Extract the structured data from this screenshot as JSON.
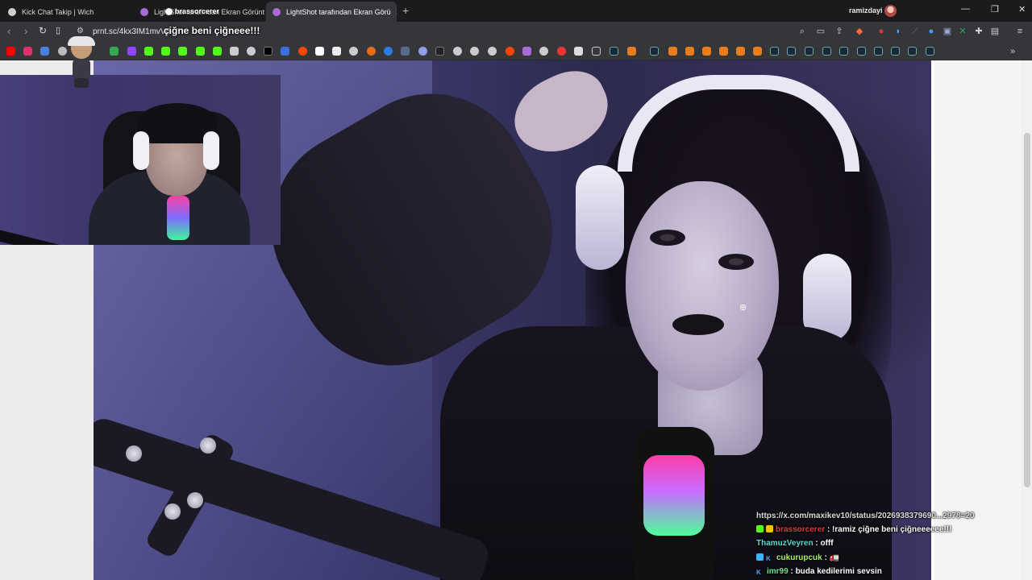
{
  "browser": {
    "tabs": [
      {
        "title": "Kick Chat Takip | Wich",
        "active": false
      },
      {
        "title": "LightShot tarafından Ekran Görüntüs",
        "active": false
      },
      {
        "title": "LightShot tarafından Ekran Görü",
        "active": true
      }
    ],
    "new_tab_label": "+",
    "close_tab_label": "×",
    "profile_name": "ramizdayi",
    "url": "prnt.sc/4kx3IM1mvV0"
  },
  "overlay": {
    "alert_user": "brassorcerer",
    "alert_message": "çiğne beni çiğneee!!!"
  },
  "chat": {
    "lines": [
      {
        "user": "",
        "text": "https://x.com/maxikev10/status/2026938379690...2978=20",
        "user_color": ""
      },
      {
        "user": "brassorcerer",
        "text": ": !ramiz çiğne beni çiğneeeeee!!!",
        "user_color": "#e03a3a"
      },
      {
        "user": "ThamuzVeyren",
        "text": ": offf",
        "user_color": "#5fd9c9"
      },
      {
        "user": "cukurupcuk",
        "text": ": 🚛",
        "user_color": "#a8f06a"
      },
      {
        "user": "imr99",
        "text": ": buda kedilerimi sevsin",
        "user_color": "#6fe28a"
      }
    ]
  },
  "colors": {
    "tab_bg": "#1b1b1d",
    "toolbar_bg": "#35363a",
    "kick_green": "#53fc18",
    "page_bg": "#ececec"
  }
}
